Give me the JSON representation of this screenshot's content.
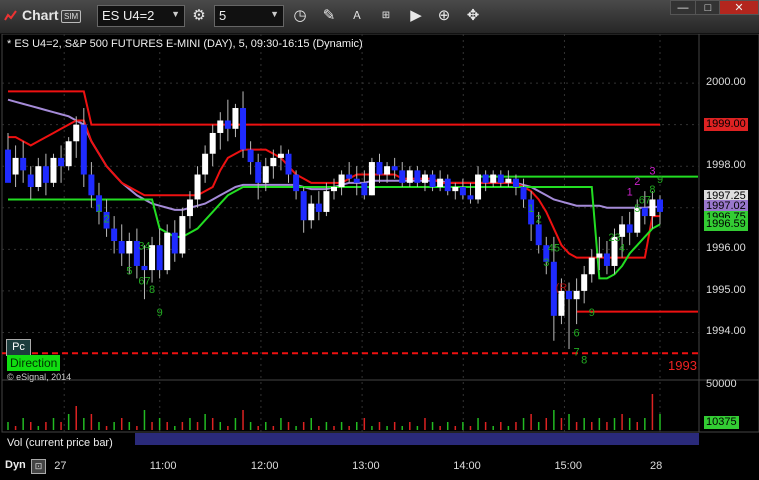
{
  "toolbar": {
    "app_title": "Chart",
    "sim_badge": "SIM",
    "symbol_value": "ES U4=2",
    "interval_value": "5",
    "icons": [
      "symbol-dropdown-icon",
      "settings-icon",
      "interval-dropdown-icon",
      "clock-icon",
      "draw-icon",
      "text-icon",
      "link-icon",
      "play-icon",
      "zoom-icon",
      "crosshair-icon"
    ]
  },
  "window_controls": {
    "minimize": "—",
    "maximize": "□",
    "close": "✕"
  },
  "chart_data": {
    "type": "candlestick",
    "title": "* ES U4=2, S&P 500 FUTURES E-MINI (DAY), 5, 09:30-16:15 (Dynamic)",
    "price_axis": {
      "ticks": [
        "2000.00",
        "1999.00",
        "1998.00",
        "1997.00",
        "1996.00",
        "1995.00",
        "1994.00"
      ],
      "range": [
        1993.0,
        2000.7
      ]
    },
    "time_axis": {
      "ticks": [
        "27",
        "11:00",
        "12:00",
        "13:00",
        "14:00",
        "15:00",
        "28"
      ]
    },
    "price_tags": [
      {
        "value": "1999.00",
        "color": "#dd2222"
      },
      {
        "value": "1997.25",
        "color": "#dddddd"
      },
      {
        "value": "1997.02",
        "color": "#9977cc"
      },
      {
        "value": "1996.75",
        "color": "#33cc33"
      },
      {
        "value": "1996.59",
        "color": "#33cc33"
      }
    ],
    "level_label": "1993",
    "buttons": {
      "pc": "Pc",
      "direction": "Direction"
    },
    "copyright": "© eSignal, 2014",
    "volume_panel": {
      "label": "Vol (current price bar)",
      "axis_tick": "50000",
      "current_value": "10375"
    },
    "bottom_bar": {
      "dyn": "Dyn"
    },
    "candles": [
      [
        1998.4,
        1998.8,
        1997.8,
        1997.6
      ],
      [
        1997.8,
        1998.5,
        1997.5,
        1998.2
      ],
      [
        1998.2,
        1998.6,
        1997.6,
        1997.9
      ],
      [
        1997.8,
        1998.0,
        1997.2,
        1997.5
      ],
      [
        1997.5,
        1998.2,
        1997.4,
        1998.0
      ],
      [
        1998.0,
        1998.3,
        1997.3,
        1997.6
      ],
      [
        1997.6,
        1998.3,
        1997.5,
        1998.2
      ],
      [
        1998.2,
        1998.5,
        1997.6,
        1998.0
      ],
      [
        1998.0,
        1998.7,
        1997.9,
        1998.6
      ],
      [
        1998.6,
        1999.2,
        1998.2,
        1999.0
      ],
      [
        1999.0,
        1999.4,
        1997.5,
        1997.8
      ],
      [
        1997.8,
        1998.1,
        1997.0,
        1997.3
      ],
      [
        1997.3,
        1997.6,
        1996.6,
        1996.9
      ],
      [
        1996.9,
        1997.2,
        1996.3,
        1996.5
      ],
      [
        1996.5,
        1996.8,
        1995.9,
        1996.2
      ],
      [
        1996.2,
        1996.6,
        1995.6,
        1995.9
      ],
      [
        1995.9,
        1996.4,
        1995.4,
        1996.2
      ],
      [
        1996.2,
        1996.5,
        1995.3,
        1995.6
      ],
      [
        1995.6,
        1996.1,
        1994.8,
        1995.5
      ],
      [
        1995.5,
        1996.3,
        1995.2,
        1996.1
      ],
      [
        1996.1,
        1996.5,
        1995.3,
        1995.5
      ],
      [
        1995.5,
        1996.6,
        1995.4,
        1996.4
      ],
      [
        1996.4,
        1996.7,
        1995.7,
        1995.9
      ],
      [
        1995.9,
        1997.0,
        1995.8,
        1996.8
      ],
      [
        1996.8,
        1997.4,
        1996.5,
        1997.2
      ],
      [
        1997.2,
        1998.0,
        1997.0,
        1997.8
      ],
      [
        1997.8,
        1998.5,
        1997.6,
        1998.3
      ],
      [
        1998.3,
        1999.0,
        1998.0,
        1998.8
      ],
      [
        1998.8,
        1999.3,
        1998.4,
        1999.1
      ],
      [
        1999.1,
        1999.6,
        1998.6,
        1998.9
      ],
      [
        1998.9,
        1999.5,
        1998.7,
        1999.4
      ],
      [
        1999.4,
        1999.8,
        1998.2,
        1998.4
      ],
      [
        1998.4,
        1998.6,
        1997.8,
        1998.1
      ],
      [
        1998.1,
        1998.3,
        1997.2,
        1997.6
      ],
      [
        1997.6,
        1998.2,
        1997.4,
        1998.0
      ],
      [
        1998.0,
        1998.4,
        1997.7,
        1998.2
      ],
      [
        1998.2,
        1998.5,
        1997.9,
        1998.3
      ],
      [
        1998.3,
        1998.4,
        1997.6,
        1997.8
      ],
      [
        1997.8,
        1997.9,
        1997.2,
        1997.4
      ],
      [
        1997.4,
        1997.5,
        1996.4,
        1996.7
      ],
      [
        1996.7,
        1997.3,
        1996.5,
        1997.1
      ],
      [
        1997.1,
        1997.4,
        1996.7,
        1996.9
      ],
      [
        1996.9,
        1997.6,
        1996.8,
        1997.4
      ],
      [
        1997.4,
        1997.7,
        1997.2,
        1997.5
      ],
      [
        1997.5,
        1997.9,
        1997.3,
        1997.8
      ],
      [
        1997.8,
        1998.1,
        1997.6,
        1997.7
      ],
      [
        1997.7,
        1998.0,
        1997.3,
        1997.6
      ],
      [
        1997.6,
        1997.9,
        1997.2,
        1997.3
      ],
      [
        1997.3,
        1998.2,
        1997.3,
        1998.1
      ],
      [
        1998.1,
        1998.3,
        1997.6,
        1997.8
      ],
      [
        1997.8,
        1998.1,
        1997.6,
        1998.0
      ],
      [
        1998.0,
        1998.2,
        1997.7,
        1997.9
      ],
      [
        1997.9,
        1998.1,
        1997.5,
        1997.6
      ],
      [
        1997.6,
        1998.0,
        1997.5,
        1997.9
      ],
      [
        1997.9,
        1998.0,
        1997.5,
        1997.6
      ],
      [
        1997.6,
        1997.9,
        1997.4,
        1997.8
      ],
      [
        1997.8,
        1997.9,
        1997.4,
        1997.5
      ],
      [
        1997.5,
        1997.9,
        1997.4,
        1997.7
      ],
      [
        1997.7,
        1997.8,
        1997.3,
        1997.4
      ],
      [
        1997.4,
        1997.6,
        1997.2,
        1997.5
      ],
      [
        1997.5,
        1997.7,
        1997.2,
        1997.3
      ],
      [
        1997.3,
        1997.6,
        1997.1,
        1997.2
      ],
      [
        1997.2,
        1998.0,
        1997.1,
        1997.8
      ],
      [
        1997.8,
        1997.9,
        1997.4,
        1997.6
      ],
      [
        1997.6,
        1997.9,
        1997.5,
        1997.8
      ],
      [
        1997.8,
        1997.9,
        1997.5,
        1997.6
      ],
      [
        1997.6,
        1997.9,
        1997.5,
        1997.7
      ],
      [
        1997.7,
        1997.8,
        1997.3,
        1997.5
      ],
      [
        1997.5,
        1997.7,
        1997.0,
        1997.2
      ],
      [
        1997.2,
        1997.4,
        1996.2,
        1996.6
      ],
      [
        1996.6,
        1996.9,
        1995.9,
        1996.1
      ],
      [
        1996.1,
        1996.3,
        1995.4,
        1995.7
      ],
      [
        1995.7,
        1996.3,
        1993.8,
        1994.4
      ],
      [
        1994.4,
        1995.3,
        1994.2,
        1995.0
      ],
      [
        1995.0,
        1995.2,
        1993.6,
        1994.8
      ],
      [
        1994.8,
        1995.3,
        1994.2,
        1995.0
      ],
      [
        1995.0,
        1995.6,
        1994.7,
        1995.4
      ],
      [
        1995.4,
        1996.0,
        1995.2,
        1995.8
      ],
      [
        1995.8,
        1996.3,
        1995.5,
        1995.9
      ],
      [
        1995.9,
        1996.2,
        1995.4,
        1995.6
      ],
      [
        1995.6,
        1996.5,
        1995.4,
        1996.3
      ],
      [
        1996.3,
        1996.8,
        1995.8,
        1996.6
      ],
      [
        1996.6,
        1996.9,
        1996.1,
        1996.4
      ],
      [
        1996.4,
        1997.2,
        1996.3,
        1997.0
      ],
      [
        1997.0,
        1997.4,
        1996.6,
        1996.8
      ],
      [
        1996.8,
        1997.4,
        1996.5,
        1997.2
      ],
      [
        1997.2,
        1997.3,
        1996.6,
        1996.9
      ]
    ],
    "lines": [
      {
        "name": "upper",
        "color": "#ee1111",
        "y": [
          1999.8,
          1999.8,
          1999.8,
          1999.8,
          1999.8,
          1999.8,
          1999.8,
          1999.8,
          1999.8,
          1999.8,
          1999.8,
          1999.0,
          1999.0,
          1999.0,
          1999.0,
          1999.0,
          1999.0,
          1999.0,
          1999.0,
          1999.0,
          1999.0,
          1999.0,
          1999.0,
          1999.0,
          1999.0,
          1999.0,
          1999.0,
          1999.0,
          1999.0,
          1999.0,
          1999.0,
          1999.0,
          1999.0,
          1999.0,
          1999.0,
          1999.0,
          1999.0,
          1999.0,
          1999.0,
          1999.0,
          1999.0,
          1999.0,
          1999.0,
          1999.0,
          1999.0,
          1999.0,
          1999.0,
          1999.0,
          1999.0,
          1999.0,
          1999.0,
          1999.0,
          1999.0,
          1999.0,
          1999.0,
          1999.0,
          1999.0,
          1999.0,
          1999.0,
          1999.0,
          1999.0,
          1999.0,
          1999.0,
          1999.0,
          1999.0,
          1999.0,
          1999.0,
          1999.0,
          1999.0,
          1999.0,
          1999.0,
          1999.0,
          1999.0,
          1999.0,
          1999.0,
          1999.0,
          1999.0,
          1999.0,
          1999.0,
          1999.0,
          1999.0,
          1999.0,
          1999.0,
          1999.0,
          1999.0,
          1999.0,
          1999.0
        ]
      },
      {
        "name": "purple",
        "color": "#a58bd8",
        "y": [
          1999.6,
          1999.55,
          1999.5,
          1999.45,
          1999.4,
          1999.35,
          1999.3,
          1999.25,
          1999.2,
          1999.1,
          1999.0,
          1998.6,
          1998.3,
          1998.0,
          1997.8,
          1997.6,
          1997.45,
          1997.3,
          1997.2,
          1997.1,
          1997.05,
          1997.0,
          1996.95,
          1996.95,
          1997.0,
          1997.05,
          1997.1,
          1997.2,
          1997.3,
          1997.4,
          1997.5,
          1997.55,
          1997.55,
          1997.55,
          1997.55,
          1997.55,
          1997.55,
          1997.55,
          1997.55,
          1997.5,
          1997.45,
          1997.45,
          1997.45,
          1997.5,
          1997.55,
          1997.6,
          1997.6,
          1997.6,
          1997.65,
          1997.65,
          1997.65,
          1997.65,
          1997.65,
          1997.65,
          1997.65,
          1997.65,
          1997.65,
          1997.65,
          1997.6,
          1997.6,
          1997.6,
          1997.6,
          1997.6,
          1997.6,
          1997.6,
          1997.6,
          1997.6,
          1997.6,
          1997.55,
          1997.5,
          1997.4,
          1997.3,
          1997.2,
          1997.15,
          1997.1,
          1997.05,
          1997.05,
          1997.05,
          1997.05,
          1997.0,
          1997.0,
          1997.0,
          1997.0,
          1997.0,
          1997.0,
          1997.02,
          1997.02
        ]
      },
      {
        "name": "red-stop",
        "color": "#ee1111",
        "y": [
          1998.7,
          1998.7,
          1998.6,
          1998.5,
          1998.6,
          1998.7,
          1998.8,
          1998.9,
          1999.0,
          1999.1,
          1999.1,
          1998.6,
          1998.3,
          1998.0,
          1997.8,
          1997.6,
          1997.5,
          1997.4,
          1997.3,
          1997.3,
          1997.3,
          1997.3,
          1997.3,
          1997.3,
          1997.3,
          1997.3,
          1997.4,
          1997.5,
          1997.9,
          1998.2,
          1998.3,
          1998.4,
          1998.4,
          1998.4,
          1998.4,
          1998.3,
          1998.2,
          1998.0,
          1997.8,
          1997.7,
          1997.6,
          1997.6,
          1997.6,
          1997.6,
          1997.6,
          1997.7,
          1997.8,
          1997.8,
          1997.8,
          1997.8,
          1997.8,
          1997.8,
          1997.7,
          1997.7,
          1997.7,
          1997.7,
          1997.7,
          1997.6,
          1997.6,
          1997.6,
          1997.6,
          1997.6,
          1997.6,
          1997.6,
          1997.6,
          1997.6,
          1997.6,
          1997.6,
          1997.5,
          1997.4,
          1997.2,
          1996.9,
          1996.5,
          1996.1,
          1995.9,
          1995.8,
          1995.8,
          1995.8,
          1995.8,
          1995.8,
          1995.8,
          1995.8,
          1995.8,
          1995.8,
          1995.8,
          1996.8,
          1996.8
        ]
      },
      {
        "name": "green-stop",
        "color": "#22dd22",
        "y": [
          1997.2,
          1997.2,
          1997.2,
          1997.2,
          1997.2,
          1997.2,
          1997.2,
          1997.2,
          1997.2,
          1997.2,
          1997.2,
          1997.2,
          1997.2,
          1997.2,
          1997.2,
          1997.2,
          1997.2,
          1997.2,
          1997.2,
          1997.2,
          1996.5,
          1996.4,
          1996.3,
          1996.3,
          1996.4,
          1996.5,
          1996.7,
          1996.9,
          1997.1,
          1997.3,
          1997.4,
          1997.5,
          1997.5,
          1997.5,
          1997.5,
          1997.5,
          1997.5,
          1997.5,
          1997.5,
          1997.5,
          1997.5,
          1997.5,
          1997.5,
          1997.5,
          1997.5,
          1997.5,
          1997.5,
          1997.5,
          1997.5,
          1997.5,
          1997.5,
          1997.5,
          1997.5,
          1997.5,
          1997.5,
          1997.5,
          1997.5,
          1997.5,
          1997.5,
          1997.5,
          1997.5,
          1997.5,
          1997.5,
          1997.5,
          1997.5,
          1997.5,
          1997.5,
          1997.5,
          1997.5,
          1997.5,
          1997.5,
          1997.5,
          1997.5,
          1997.5,
          1997.5,
          1997.5,
          1997.5,
          1997.5,
          1995.3,
          1995.3,
          1995.4,
          1995.6,
          1995.9,
          1996.1,
          1996.3,
          1996.5,
          1996.6
        ]
      }
    ],
    "horizontal_levels": [
      {
        "value": 1997.75,
        "color": "#22dd22",
        "from_bar": 62
      },
      {
        "value": 1994.5,
        "color": "#ee1111",
        "from_bar": 75
      },
      {
        "value": 1993.5,
        "color": "#ee1111",
        "dashed": true
      }
    ],
    "count_labels": [
      {
        "text": "1",
        "bar": 12,
        "value": 1996.9,
        "color": "#22aa22"
      },
      {
        "text": "2",
        "bar": 13,
        "value": 1996.65,
        "color": "#22aa22"
      },
      {
        "text": "34",
        "bar": 18,
        "value": 1996.0,
        "color": "#22aa22"
      },
      {
        "text": "5",
        "bar": 16,
        "value": 1995.4,
        "color": "#22aa22"
      },
      {
        "text": "67",
        "bar": 18,
        "value": 1995.15,
        "color": "#22aa22"
      },
      {
        "text": "8",
        "bar": 19,
        "value": 1994.95,
        "color": "#22aa22"
      },
      {
        "text": "9",
        "bar": 20,
        "value": 1994.4,
        "color": "#22aa22"
      },
      {
        "text": "1",
        "bar": 69,
        "value": 1996.9,
        "color": "#22aa22"
      },
      {
        "text": "2",
        "bar": 70,
        "value": 1996.65,
        "color": "#22aa22"
      },
      {
        "text": "3",
        "bar": 71,
        "value": 1995.6,
        "color": "#22aa22"
      },
      {
        "text": "45",
        "bar": 72,
        "value": 1995.95,
        "color": "#22aa22"
      },
      {
        "text": "(R",
        "bar": 73,
        "value": 1995.0,
        "color": "#aa1111"
      },
      {
        "text": "9",
        "bar": 77,
        "value": 1994.4,
        "color": "#22aa22"
      },
      {
        "text": "6",
        "bar": 75,
        "value": 1993.9,
        "color": "#22aa22"
      },
      {
        "text": "7",
        "bar": 75,
        "value": 1993.45,
        "color": "#22aa22"
      },
      {
        "text": "8",
        "bar": 76,
        "value": 1993.25,
        "color": "#22aa22"
      },
      {
        "text": "23",
        "bar": 80,
        "value": 1996.2,
        "color": "#22aa22"
      },
      {
        "text": "4",
        "bar": 81,
        "value": 1995.95,
        "color": "#22aa22"
      },
      {
        "text": "5",
        "bar": 83,
        "value": 1996.9,
        "color": "#22aa22"
      },
      {
        "text": "67",
        "bar": 84,
        "value": 1997.1,
        "color": "#22aa22"
      },
      {
        "text": "8",
        "bar": 85,
        "value": 1997.35,
        "color": "#22aa22"
      },
      {
        "text": "9",
        "bar": 86,
        "value": 1997.6,
        "color": "#22aa22"
      },
      {
        "text": "1",
        "bar": 82,
        "value": 1997.3,
        "color": "#cc22cc"
      },
      {
        "text": "2",
        "bar": 83,
        "value": 1997.55,
        "color": "#cc22cc"
      },
      {
        "text": "3",
        "bar": 85,
        "value": 1997.8,
        "color": "#cc22cc"
      }
    ],
    "volume": [
      2,
      1,
      3,
      2,
      1,
      2,
      3,
      2,
      4,
      6,
      3,
      4,
      2,
      1,
      2,
      3,
      2,
      1,
      5,
      2,
      3,
      2,
      1,
      2,
      3,
      2,
      4,
      3,
      2,
      1,
      3,
      5,
      2,
      1,
      2,
      1,
      3,
      2,
      1,
      2,
      3,
      1,
      2,
      1,
      2,
      1,
      2,
      3,
      1,
      2,
      1,
      2,
      1,
      2,
      1,
      3,
      2,
      1,
      2,
      1,
      2,
      1,
      3,
      2,
      1,
      2,
      1,
      2,
      3,
      4,
      2,
      3,
      5,
      3,
      4,
      2,
      3,
      2,
      3,
      2,
      3,
      4,
      3,
      2,
      3,
      9,
      4
    ]
  }
}
